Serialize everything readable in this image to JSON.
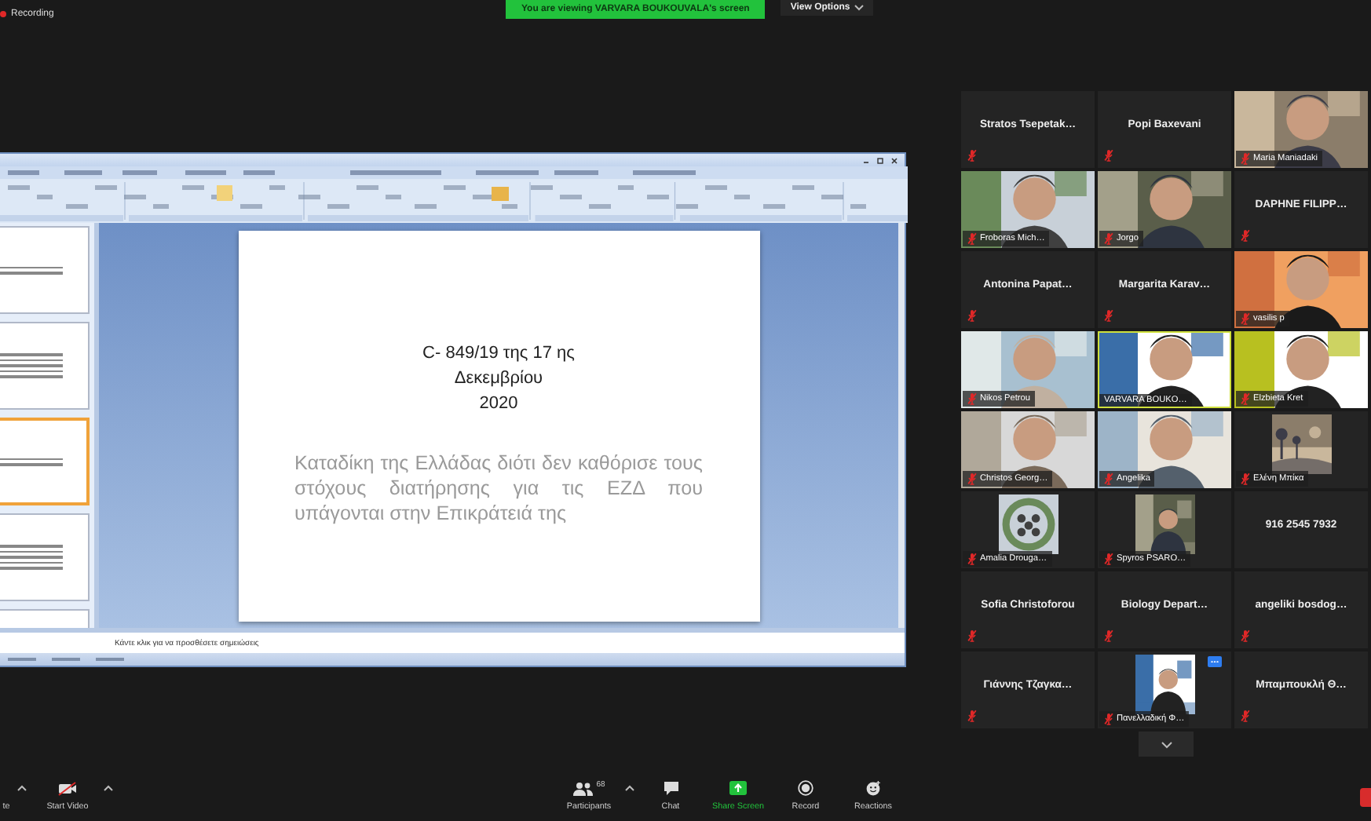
{
  "top_bar": {
    "recording_label": "Recording",
    "banner": "You are viewing VARVARA BOUKOUVALA's screen",
    "view_options": "View Options"
  },
  "presentation": {
    "thumbnails": [
      {
        "selected": false
      },
      {
        "selected": false
      },
      {
        "selected": true
      },
      {
        "selected": false
      },
      {
        "selected": false
      }
    ],
    "slide": {
      "title_lines": [
        "C- 849/19 της 17 ης",
        "Δεκεμβρίου",
        "2020"
      ],
      "body": "Καταδίκη της Ελλάδας διότι δεν καθόρισε τους στόχους διατήρησης για τις ΕΖΔ που υπάγονται στην Επικράτειά της"
    },
    "notes_prompt": "Κάντε κλικ για να προσθέσετε σημειώσεις"
  },
  "gallery": {
    "tiles": [
      {
        "kind": "name",
        "name": "Stratos  Tsepetak…",
        "muted": true,
        "active": false,
        "hovered": false
      },
      {
        "kind": "name",
        "name": "Popi Baxevani",
        "muted": true,
        "active": false,
        "hovered": false
      },
      {
        "kind": "video",
        "name": "Maria Maniadaki",
        "muted": true,
        "active": false,
        "hovered": false
      },
      {
        "kind": "video",
        "name": "Froboras Mich…",
        "muted": true,
        "active": false,
        "hovered": false
      },
      {
        "kind": "video",
        "name": "Jorgo",
        "muted": true,
        "active": false,
        "hovered": false
      },
      {
        "kind": "name",
        "name": "DAPHNE FILIPP…",
        "muted": true,
        "active": false,
        "hovered": false
      },
      {
        "kind": "name",
        "name": "Antonina  Papat…",
        "muted": true,
        "active": false,
        "hovered": false
      },
      {
        "kind": "name",
        "name": "Margarita  Karav…",
        "muted": true,
        "active": false,
        "hovered": false
      },
      {
        "kind": "video",
        "name": "vasilis p",
        "muted": true,
        "active": false,
        "hovered": false
      },
      {
        "kind": "video",
        "name": "Nikos Petrou",
        "muted": true,
        "active": false,
        "hovered": false
      },
      {
        "kind": "video",
        "name": "VARVARA BOUKO…",
        "muted": false,
        "active": true,
        "hovered": false
      },
      {
        "kind": "video",
        "name": "Elzbieta Kret",
        "muted": true,
        "active": false,
        "hovered": false
      },
      {
        "kind": "video",
        "name": "Christos Georg…",
        "muted": true,
        "active": false,
        "hovered": false
      },
      {
        "kind": "video",
        "name": "Angelika",
        "muted": true,
        "active": false,
        "hovered": false
      },
      {
        "kind": "avatar",
        "name": "Ελένη Μπίκα",
        "muted": true,
        "active": false,
        "hovered": false
      },
      {
        "kind": "avatar",
        "name": "Amalia Drouga…",
        "muted": true,
        "active": false,
        "hovered": false
      },
      {
        "kind": "avatar",
        "name": "Spyros PSARO…",
        "muted": true,
        "active": false,
        "hovered": false
      },
      {
        "kind": "name",
        "name": "916 2545 7932",
        "muted": false,
        "active": false,
        "hovered": false
      },
      {
        "kind": "name",
        "name": "Sofia Christoforou",
        "muted": true,
        "active": false,
        "hovered": false
      },
      {
        "kind": "name",
        "name": "Biology  Depart…",
        "muted": true,
        "active": false,
        "hovered": false
      },
      {
        "kind": "name",
        "name": "angeliki  bosdog…",
        "muted": true,
        "active": false,
        "hovered": false
      },
      {
        "kind": "name",
        "name": "Γιάννης Τζαγκα…",
        "muted": true,
        "active": false,
        "hovered": false
      },
      {
        "kind": "avatar",
        "name": "Πανελλαδική Φ…",
        "muted": true,
        "active": false,
        "hovered": true
      },
      {
        "kind": "name",
        "name": "Μπαμπουκλή Θ…",
        "muted": true,
        "active": false,
        "hovered": false
      }
    ]
  },
  "toolbar": {
    "items": [
      {
        "kind": "mute",
        "label": "te"
      },
      {
        "kind": "video",
        "label": "Start Video"
      },
      {
        "kind": "participants",
        "label": "Participants",
        "count": "68"
      },
      {
        "kind": "chat",
        "label": "Chat"
      },
      {
        "kind": "share",
        "label": "Share Screen"
      },
      {
        "kind": "record",
        "label": "Record"
      },
      {
        "kind": "reactions",
        "label": "Reactions"
      }
    ]
  }
}
